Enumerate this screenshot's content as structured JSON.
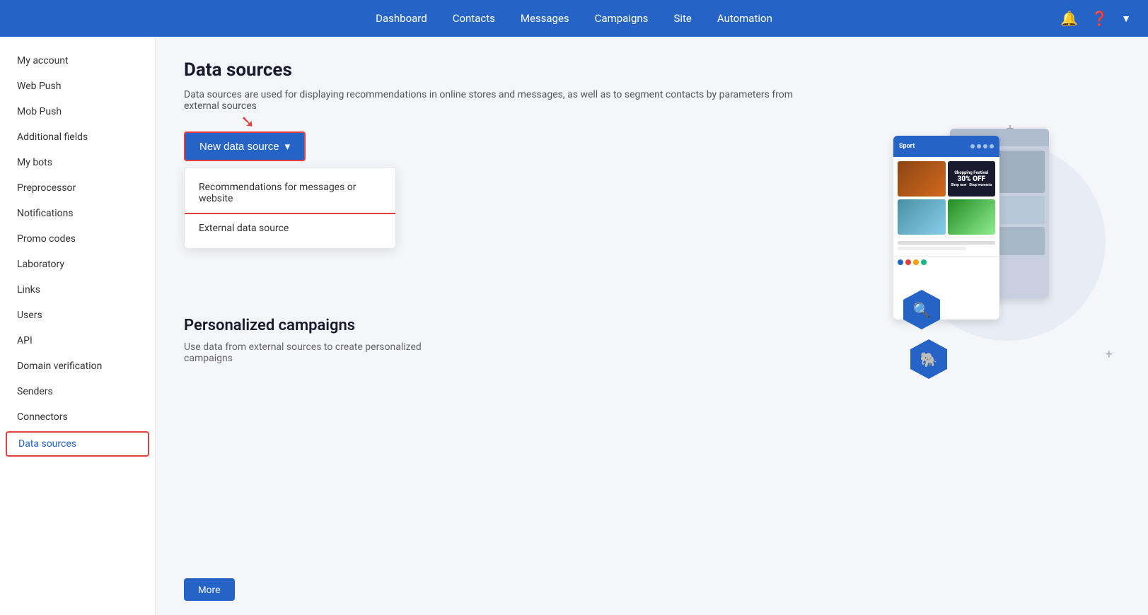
{
  "topNav": {
    "links": [
      {
        "label": "Dashboard",
        "key": "dashboard"
      },
      {
        "label": "Contacts",
        "key": "contacts"
      },
      {
        "label": "Messages",
        "key": "messages"
      },
      {
        "label": "Campaigns",
        "key": "campaigns"
      },
      {
        "label": "Site",
        "key": "site"
      },
      {
        "label": "Automation",
        "key": "automation"
      }
    ]
  },
  "sidebar": {
    "items": [
      {
        "label": "My account",
        "key": "my-account",
        "active": false
      },
      {
        "label": "Web Push",
        "key": "web-push",
        "active": false
      },
      {
        "label": "Mob Push",
        "key": "mob-push",
        "active": false
      },
      {
        "label": "Additional fields",
        "key": "additional-fields",
        "active": false
      },
      {
        "label": "My bots",
        "key": "my-bots",
        "active": false
      },
      {
        "label": "Preprocessor",
        "key": "preprocessor",
        "active": false
      },
      {
        "label": "Notifications",
        "key": "notifications",
        "active": false
      },
      {
        "label": "Promo codes",
        "key": "promo-codes",
        "active": false
      },
      {
        "label": "Laboratory",
        "key": "laboratory",
        "active": false
      },
      {
        "label": "Links",
        "key": "links",
        "active": false
      },
      {
        "label": "Users",
        "key": "users",
        "active": false
      },
      {
        "label": "API",
        "key": "api",
        "active": false
      },
      {
        "label": "Domain verification",
        "key": "domain-verification",
        "active": false
      },
      {
        "label": "Senders",
        "key": "senders",
        "active": false
      },
      {
        "label": "Connectors",
        "key": "connectors",
        "active": false
      },
      {
        "label": "Data sources",
        "key": "data-sources",
        "active": true
      }
    ]
  },
  "main": {
    "title": "Data sources",
    "description": "Data sources are used for displaying recommendations in online stores and messages, as well as to segment contacts by parameters from external sources",
    "newDataSourceButton": "New data source",
    "dropdown": {
      "items": [
        {
          "label": "Recommendations for messages or website",
          "key": "recommendations"
        },
        {
          "label": "External data source",
          "key": "external"
        }
      ]
    },
    "promo": {
      "title": "Personalized campaigns",
      "description": "Use data from external sources to create personalized campaigns"
    },
    "moreButton": "More"
  }
}
